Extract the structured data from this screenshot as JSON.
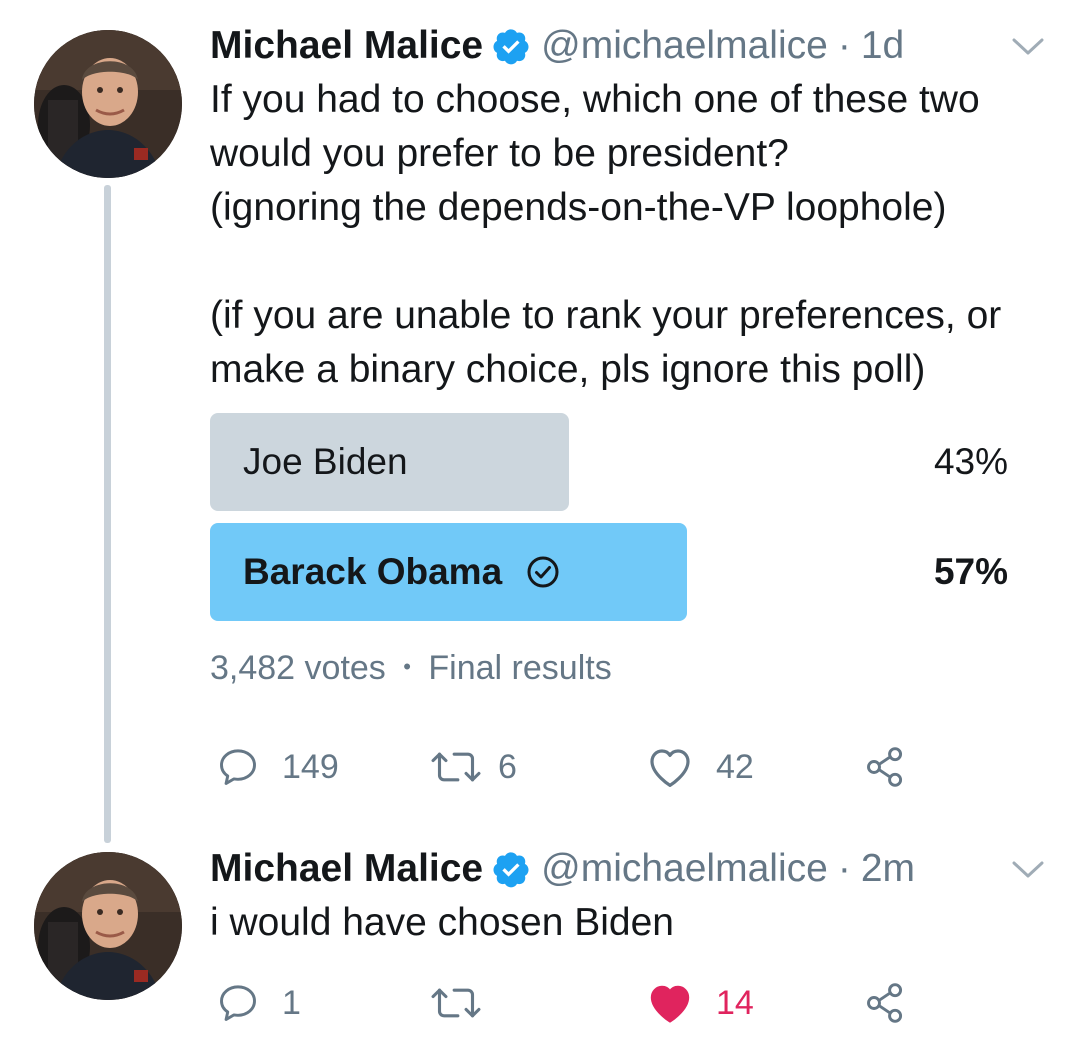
{
  "colors": {
    "text": "#14171a",
    "muted": "#657786",
    "verified": "#1da1f2",
    "poll_loser": "#ccd6dd",
    "poll_winner": "#71c9f8",
    "like_active": "#e0245e",
    "thread_line": "#c8d1d9"
  },
  "tweets": [
    {
      "author": {
        "display_name": "Michael Malice",
        "handle": "@michaelmalice",
        "verified": true,
        "avatar_icon": "avatar-photo"
      },
      "time": "1d",
      "text": "If you had to choose, which one of these two\nwould you prefer to be president?\n(ignoring the depends-on-the-VP loophole)\n\n(if you are unable to rank your preferences, or\nmake a binary choice, pls ignore this poll)",
      "poll": {
        "options": [
          {
            "label": "Joe Biden",
            "percent_label": "43%",
            "percent": 43,
            "winner": false
          },
          {
            "label": "Barack Obama",
            "percent_label": "57%",
            "percent": 57,
            "winner": true
          }
        ],
        "votes": "3,482 votes",
        "separator": "•",
        "status": "Final results"
      },
      "actions": {
        "reply": {
          "icon": "reply-icon",
          "count": "149"
        },
        "retweet": {
          "icon": "retweet-icon",
          "count": "6"
        },
        "like": {
          "icon": "heart-outline-icon",
          "count": "42",
          "active": false
        },
        "share": {
          "icon": "share-icon"
        }
      }
    },
    {
      "author": {
        "display_name": "Michael Malice",
        "handle": "@michaelmalice",
        "verified": true,
        "avatar_icon": "avatar-photo"
      },
      "time": "2m",
      "text": "i would have chosen Biden",
      "actions": {
        "reply": {
          "icon": "reply-icon",
          "count": "1"
        },
        "retweet": {
          "icon": "retweet-icon",
          "count": ""
        },
        "like": {
          "icon": "heart-filled-icon",
          "count": "14",
          "active": true
        },
        "share": {
          "icon": "share-icon"
        }
      }
    }
  ],
  "dot_separator": "·"
}
